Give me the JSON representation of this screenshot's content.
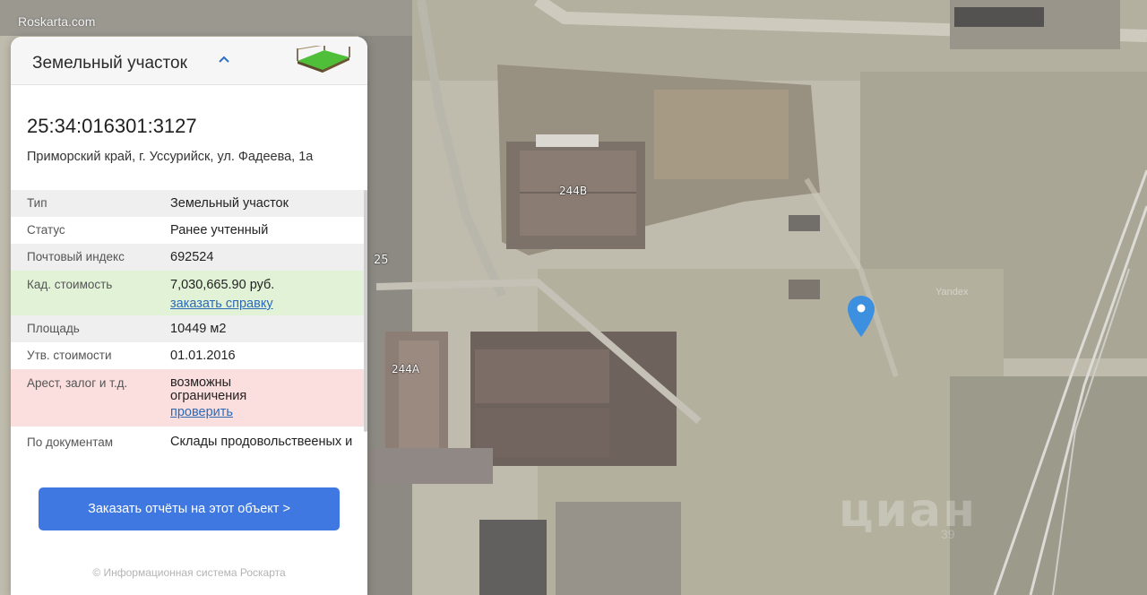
{
  "map": {
    "brand": "Roskarta.com",
    "building_labels": [
      "244В",
      "244А",
      "25"
    ],
    "watermark": "циан",
    "watermark_sub": "39",
    "yandex": "Yandex",
    "marker_color": "#3d8fe0"
  },
  "card": {
    "title": "Земельный участок",
    "cadastral_number": "25:34:016301:3127",
    "address": "Приморский край, г. Уссурийск, ул. Фадеева, 1а",
    "rows": [
      {
        "label": "Тип",
        "value": "Земельный участок"
      },
      {
        "label": "Статус",
        "value": "Ранее учтенный"
      },
      {
        "label": "Почтовый индекс",
        "value": "692524"
      },
      {
        "label": "Кад. стоимость",
        "value": "7,030,665.90 руб.",
        "link": "заказать справку"
      },
      {
        "label": "Площадь",
        "value": "10449 м2"
      },
      {
        "label": "Утв. стоимости",
        "value": "01.01.2016"
      },
      {
        "label": "Арест, залог и т.д.",
        "value": "возможны ограничения",
        "link": "проверить"
      },
      {
        "label": "По документам",
        "value": "Склады продовольствееных и"
      }
    ],
    "order_button": "Заказать отчёты на этот объект >",
    "copyright": "© Информационная система Роскарта",
    "colors": {
      "green_row": "#e1f2d7",
      "red_row": "#fbdede",
      "link": "#2c6ab6",
      "button": "#3f78e0"
    }
  }
}
